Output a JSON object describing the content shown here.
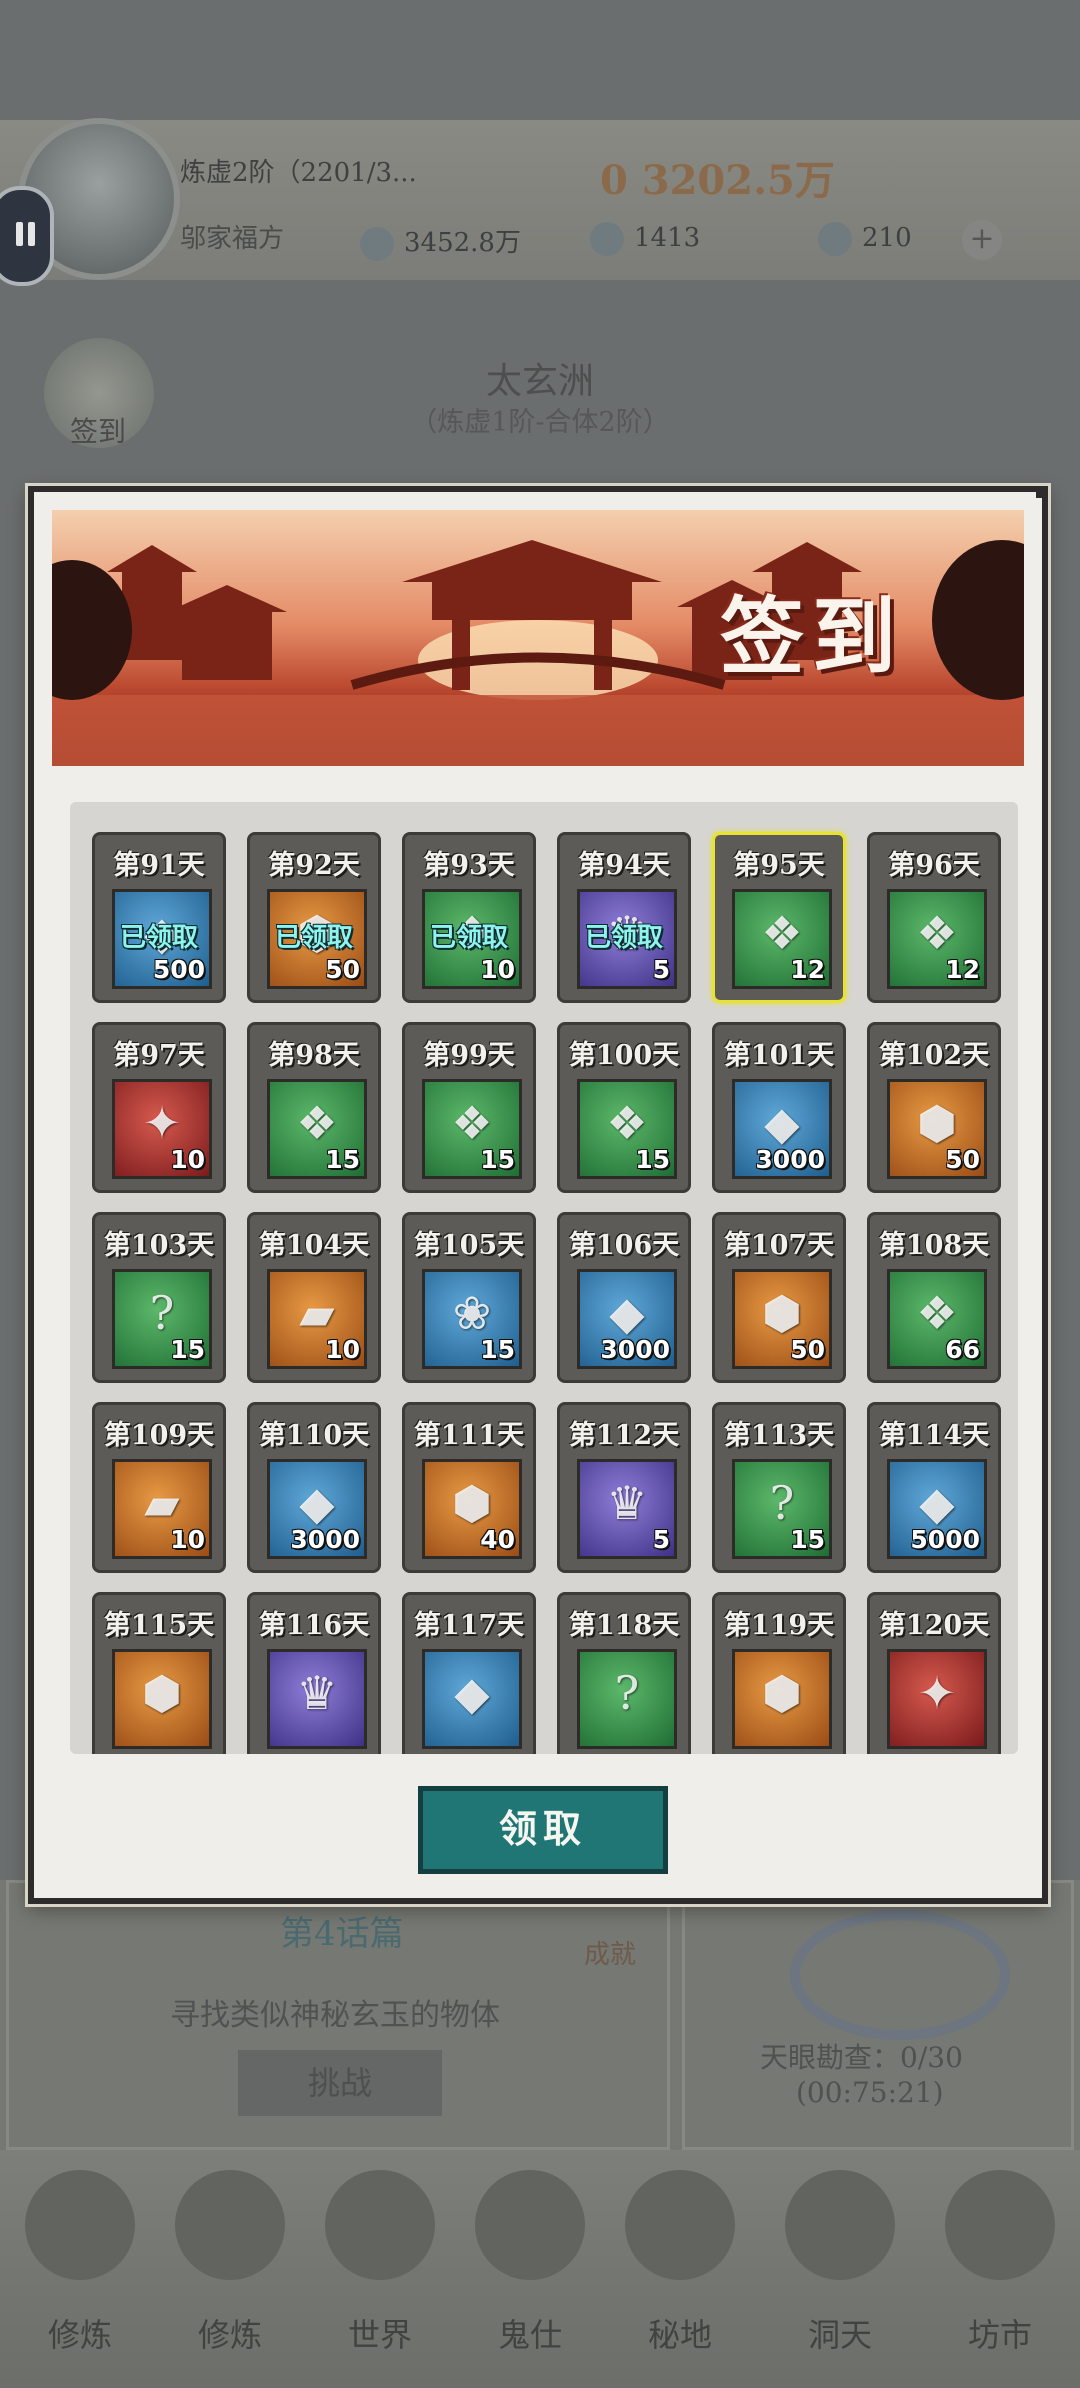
{
  "header": {
    "rank": "炼虚2阶（2201/3...",
    "name": "邬家福方",
    "power": "0 3202.5万",
    "resources": [
      "3452.8万",
      "1413",
      "210"
    ]
  },
  "region": {
    "name": "太玄洲",
    "range": "（炼虚1阶-合体2阶）",
    "sign_label": "签到"
  },
  "quest": {
    "title": "第4话篇",
    "desc": "寻找类似神秘玄玉的物体",
    "challenge": "挑战",
    "badge": "成就"
  },
  "eye": {
    "label": "天眼勘查：0/30",
    "timer": "(00:75:21)"
  },
  "bottom_nav": [
    "修炼",
    "修炼",
    "世界",
    "鬼仕",
    "秘地",
    "洞天",
    "坊市"
  ],
  "dialog": {
    "banner_title": "签到",
    "claimed_label": "已领取",
    "claim_button": "领取"
  },
  "days": [
    {
      "label": "第91天",
      "qty": "500",
      "color": "blue",
      "icon": "crystal-icon",
      "claimed": true
    },
    {
      "label": "第92天",
      "qty": "50",
      "color": "orange",
      "icon": "ore-icon",
      "claimed": true
    },
    {
      "label": "第93天",
      "qty": "10",
      "color": "green",
      "icon": "jade-icon",
      "claimed": true
    },
    {
      "label": "第94天",
      "qty": "5",
      "color": "purple",
      "icon": "robe-icon",
      "claimed": true
    },
    {
      "label": "第95天",
      "qty": "12",
      "color": "green",
      "icon": "jade-icon",
      "claimed": false,
      "current": true
    },
    {
      "label": "第96天",
      "qty": "12",
      "color": "green",
      "icon": "jade-icon",
      "claimed": false
    },
    {
      "label": "第97天",
      "qty": "10",
      "color": "red",
      "icon": "scroll-icon",
      "claimed": false
    },
    {
      "label": "第98天",
      "qty": "15",
      "color": "green",
      "icon": "jade-icon",
      "claimed": false
    },
    {
      "label": "第99天",
      "qty": "15",
      "color": "green",
      "icon": "jade-icon",
      "claimed": false
    },
    {
      "label": "第100天",
      "qty": "15",
      "color": "green",
      "icon": "jade-icon",
      "claimed": false
    },
    {
      "label": "第101天",
      "qty": "3000",
      "color": "blue",
      "icon": "crystal-icon",
      "claimed": false
    },
    {
      "label": "第102天",
      "qty": "50",
      "color": "orange",
      "icon": "ore-icon",
      "claimed": false
    },
    {
      "label": "第103天",
      "qty": "15",
      "color": "green",
      "icon": "mystery-icon",
      "claimed": false
    },
    {
      "label": "第104天",
      "qty": "10",
      "color": "orange",
      "icon": "book-icon",
      "claimed": false
    },
    {
      "label": "第105天",
      "qty": "15",
      "color": "blue",
      "icon": "beast-icon",
      "claimed": false
    },
    {
      "label": "第106天",
      "qty": "3000",
      "color": "blue",
      "icon": "crystal-icon",
      "claimed": false
    },
    {
      "label": "第107天",
      "qty": "50",
      "color": "orange",
      "icon": "ore-icon",
      "claimed": false
    },
    {
      "label": "第108天",
      "qty": "66",
      "color": "green",
      "icon": "jade-icon",
      "claimed": false
    },
    {
      "label": "第109天",
      "qty": "10",
      "color": "orange",
      "icon": "book-icon",
      "claimed": false
    },
    {
      "label": "第110天",
      "qty": "3000",
      "color": "blue",
      "icon": "crystal-icon",
      "claimed": false
    },
    {
      "label": "第111天",
      "qty": "40",
      "color": "orange",
      "icon": "ore-icon",
      "claimed": false
    },
    {
      "label": "第112天",
      "qty": "5",
      "color": "purple",
      "icon": "robe-icon",
      "claimed": false
    },
    {
      "label": "第113天",
      "qty": "15",
      "color": "green",
      "icon": "mystery-icon",
      "claimed": false
    },
    {
      "label": "第114天",
      "qty": "5000",
      "color": "blue",
      "icon": "crystal-icon",
      "claimed": false
    },
    {
      "label": "第115天",
      "qty": "",
      "color": "orange",
      "icon": "ore-icon",
      "claimed": false
    },
    {
      "label": "第116天",
      "qty": "",
      "color": "purple",
      "icon": "robe-icon",
      "claimed": false
    },
    {
      "label": "第117天",
      "qty": "",
      "color": "blue",
      "icon": "crystal-icon",
      "claimed": false
    },
    {
      "label": "第118天",
      "qty": "",
      "color": "green",
      "icon": "mystery-icon",
      "claimed": false
    },
    {
      "label": "第119天",
      "qty": "",
      "color": "orange",
      "icon": "ore-icon",
      "claimed": false
    },
    {
      "label": "第120天",
      "qty": "",
      "color": "red",
      "icon": "scroll-icon",
      "claimed": false
    }
  ]
}
